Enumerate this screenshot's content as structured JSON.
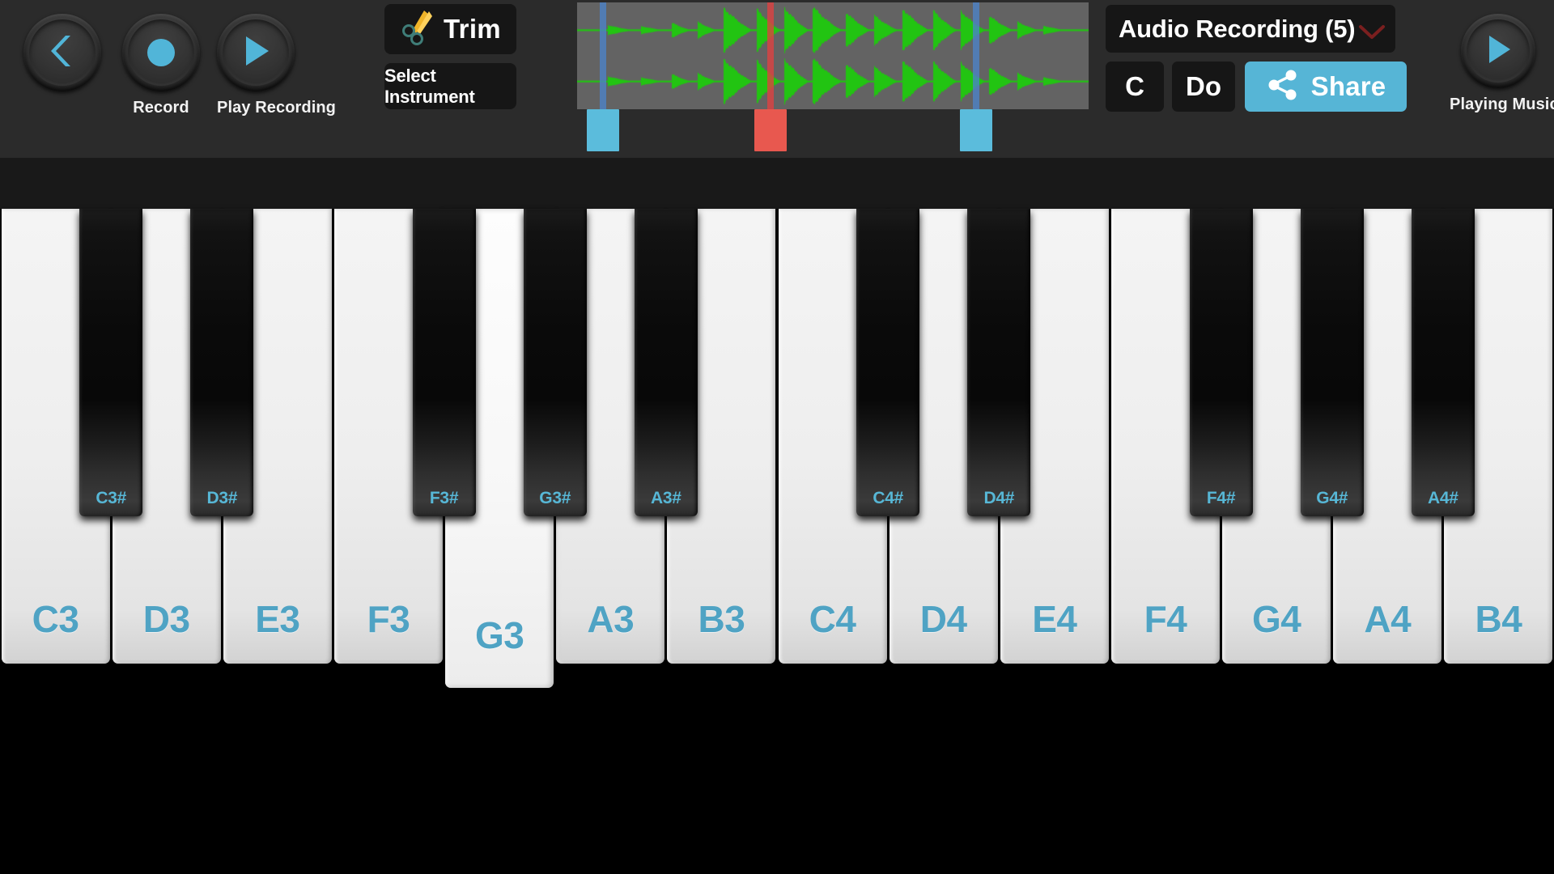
{
  "toolbar": {
    "back_button": {
      "name": "Back",
      "icon": "chevron-left-icon"
    },
    "record_button": {
      "label": "Record",
      "icon": "record-dot-icon"
    },
    "play_recording_button": {
      "label": "Play Recording",
      "icon": "play-triangle-icon"
    },
    "trim_button": {
      "label": "Trim",
      "icon": "scissors-icon"
    },
    "select_instrument_button": {
      "label": "Select Instrument"
    },
    "title_button": {
      "label": "Audio Recording (5)",
      "icon": "chevron-down-icon",
      "chevron_color": "#7a1f1f"
    },
    "c_button": {
      "label": "C"
    },
    "do_button": {
      "label": "Do"
    },
    "share_button": {
      "label": "Share",
      "icon": "share-nodes-icon",
      "color": "#56b5d6"
    },
    "playing_music_button": {
      "label": "Playing Music",
      "icon": "play-triangle-icon"
    }
  },
  "waveform": {
    "background": "#636363",
    "wave_color": "#22c412",
    "start_marker": {
      "color": "#5bbcdc",
      "position_pct": 5.0
    },
    "playhead_marker": {
      "color": "#e8584f",
      "position_pct": 37.8
    },
    "end_marker": {
      "color": "#5bbcdc",
      "position_pct": 78.0
    }
  },
  "colors": {
    "accent": "#51b5d8",
    "key_label": "#4fa3c4",
    "black_key_label": "#57b7d6",
    "toolbar_bg": "#2b2b2b",
    "button_bg": "#161616"
  },
  "keyboard": {
    "white_keys": [
      {
        "label": "C3",
        "pressed": false
      },
      {
        "label": "D3",
        "pressed": false
      },
      {
        "label": "E3",
        "pressed": false
      },
      {
        "label": "F3",
        "pressed": false
      },
      {
        "label": "G3",
        "pressed": true
      },
      {
        "label": "A3",
        "pressed": false
      },
      {
        "label": "B3",
        "pressed": false
      },
      {
        "label": "C4",
        "pressed": false
      },
      {
        "label": "D4",
        "pressed": false
      },
      {
        "label": "E4",
        "pressed": false
      },
      {
        "label": "F4",
        "pressed": false
      },
      {
        "label": "G4",
        "pressed": false
      },
      {
        "label": "A4",
        "pressed": false
      },
      {
        "label": "B4",
        "pressed": false
      }
    ],
    "black_keys": [
      {
        "label": "C3#",
        "after_white_index": 0
      },
      {
        "label": "D3#",
        "after_white_index": 1
      },
      {
        "label": "F3#",
        "after_white_index": 3
      },
      {
        "label": "G3#",
        "after_white_index": 4
      },
      {
        "label": "A3#",
        "after_white_index": 5
      },
      {
        "label": "C4#",
        "after_white_index": 7
      },
      {
        "label": "D4#",
        "after_white_index": 8
      },
      {
        "label": "F4#",
        "after_white_index": 10
      },
      {
        "label": "G4#",
        "after_white_index": 11
      },
      {
        "label": "A4#",
        "after_white_index": 12
      }
    ]
  }
}
